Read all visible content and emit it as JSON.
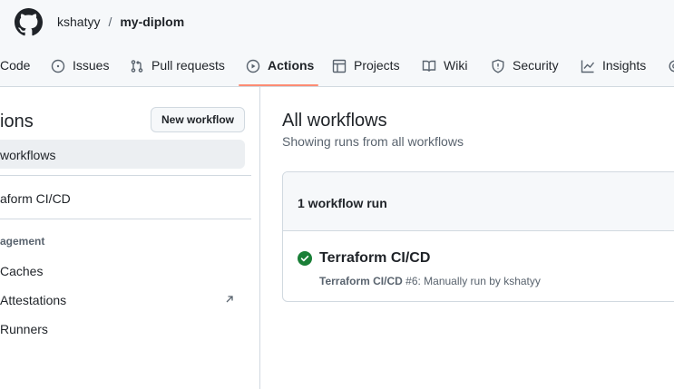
{
  "header": {
    "logo_icon": "github-mark-icon",
    "owner": "kshatyy",
    "separator": "/",
    "repo": "my-diplom"
  },
  "nav": {
    "items": [
      {
        "label": "Code",
        "icon": "code-icon"
      },
      {
        "label": "Issues",
        "icon": "issue-opened-icon"
      },
      {
        "label": "Pull requests",
        "icon": "git-pull-request-icon"
      },
      {
        "label": "Actions",
        "icon": "play-icon",
        "active": true
      },
      {
        "label": "Projects",
        "icon": "table-icon"
      },
      {
        "label": "Wiki",
        "icon": "book-icon"
      },
      {
        "label": "Security",
        "icon": "shield-icon"
      },
      {
        "label": "Insights",
        "icon": "graph-icon"
      }
    ],
    "active_color": "#fd8c73"
  },
  "sidebar": {
    "title": "ions",
    "new_workflow": "New workflow",
    "all_workflows": "workflows",
    "workflows": [
      "aform CI/CD"
    ],
    "management_heading": "agement",
    "management_items": [
      "Caches",
      "Attestations",
      "Runners"
    ]
  },
  "main": {
    "title": "All workflows",
    "subtitle": "Showing runs from all workflows",
    "runs_count": "1 workflow run",
    "run": {
      "title": "Terraform CI/CD",
      "workflow": "Terraform CI/CD",
      "number": "#6",
      "trigger": ": Manually run by kshatyy",
      "status_icon": "check-circle-fill-icon",
      "status_color": "#1a7f37"
    }
  }
}
